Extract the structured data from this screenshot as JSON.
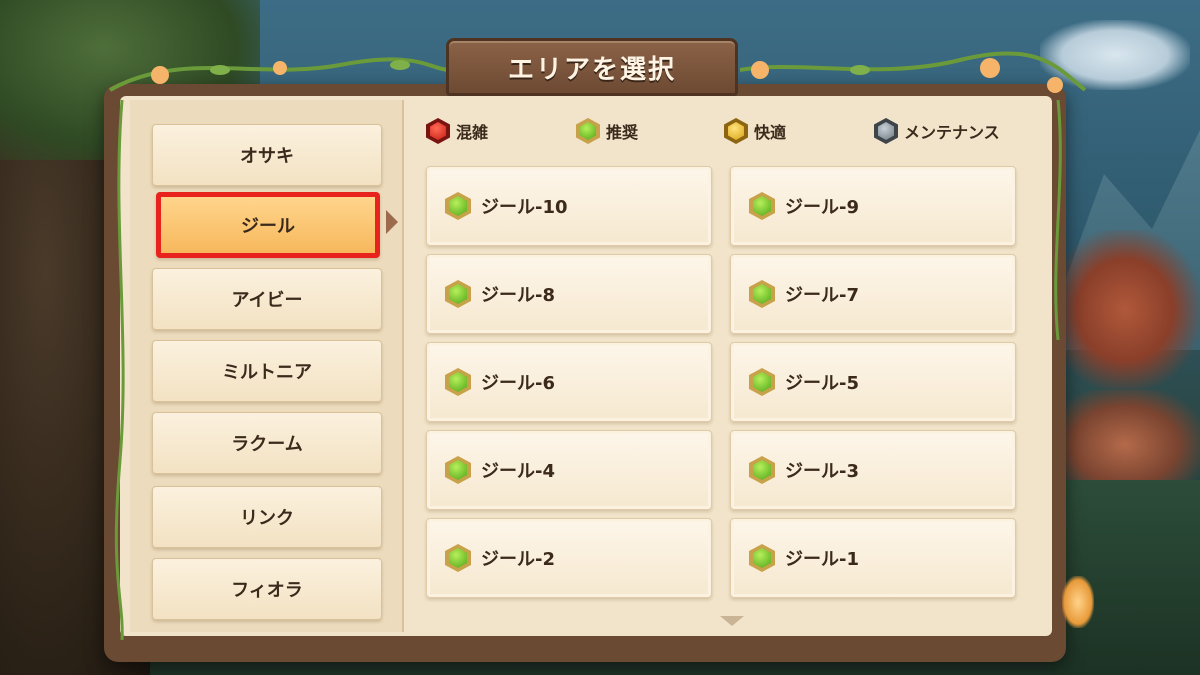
{
  "title": "エリアを選択",
  "legend": [
    {
      "label": "混雑",
      "color": "red"
    },
    {
      "label": "推奨",
      "color": "green"
    },
    {
      "label": "快適",
      "color": "yellow"
    },
    {
      "label": "メンテナンス",
      "color": "gray"
    }
  ],
  "areas": [
    {
      "label": "オサキ",
      "selected": false
    },
    {
      "label": "ジール",
      "selected": true
    },
    {
      "label": "アイビー",
      "selected": false
    },
    {
      "label": "ミルトニア",
      "selected": false
    },
    {
      "label": "ラクーム",
      "selected": false
    },
    {
      "label": "リンク",
      "selected": false
    },
    {
      "label": "フィオラ",
      "selected": false
    }
  ],
  "servers": [
    {
      "name": "ジール-10",
      "status": "green"
    },
    {
      "name": "ジール-9",
      "status": "green"
    },
    {
      "name": "ジール-8",
      "status": "green"
    },
    {
      "name": "ジール-7",
      "status": "green"
    },
    {
      "name": "ジール-6",
      "status": "green"
    },
    {
      "name": "ジール-5",
      "status": "green"
    },
    {
      "name": "ジール-4",
      "status": "green"
    },
    {
      "name": "ジール-3",
      "status": "green"
    },
    {
      "name": "ジール-2",
      "status": "green"
    },
    {
      "name": "ジール-1",
      "status": "green"
    }
  ],
  "icons": {
    "scroll": "chevron-down-icon",
    "selection_arrow": "chevron-right-icon"
  }
}
